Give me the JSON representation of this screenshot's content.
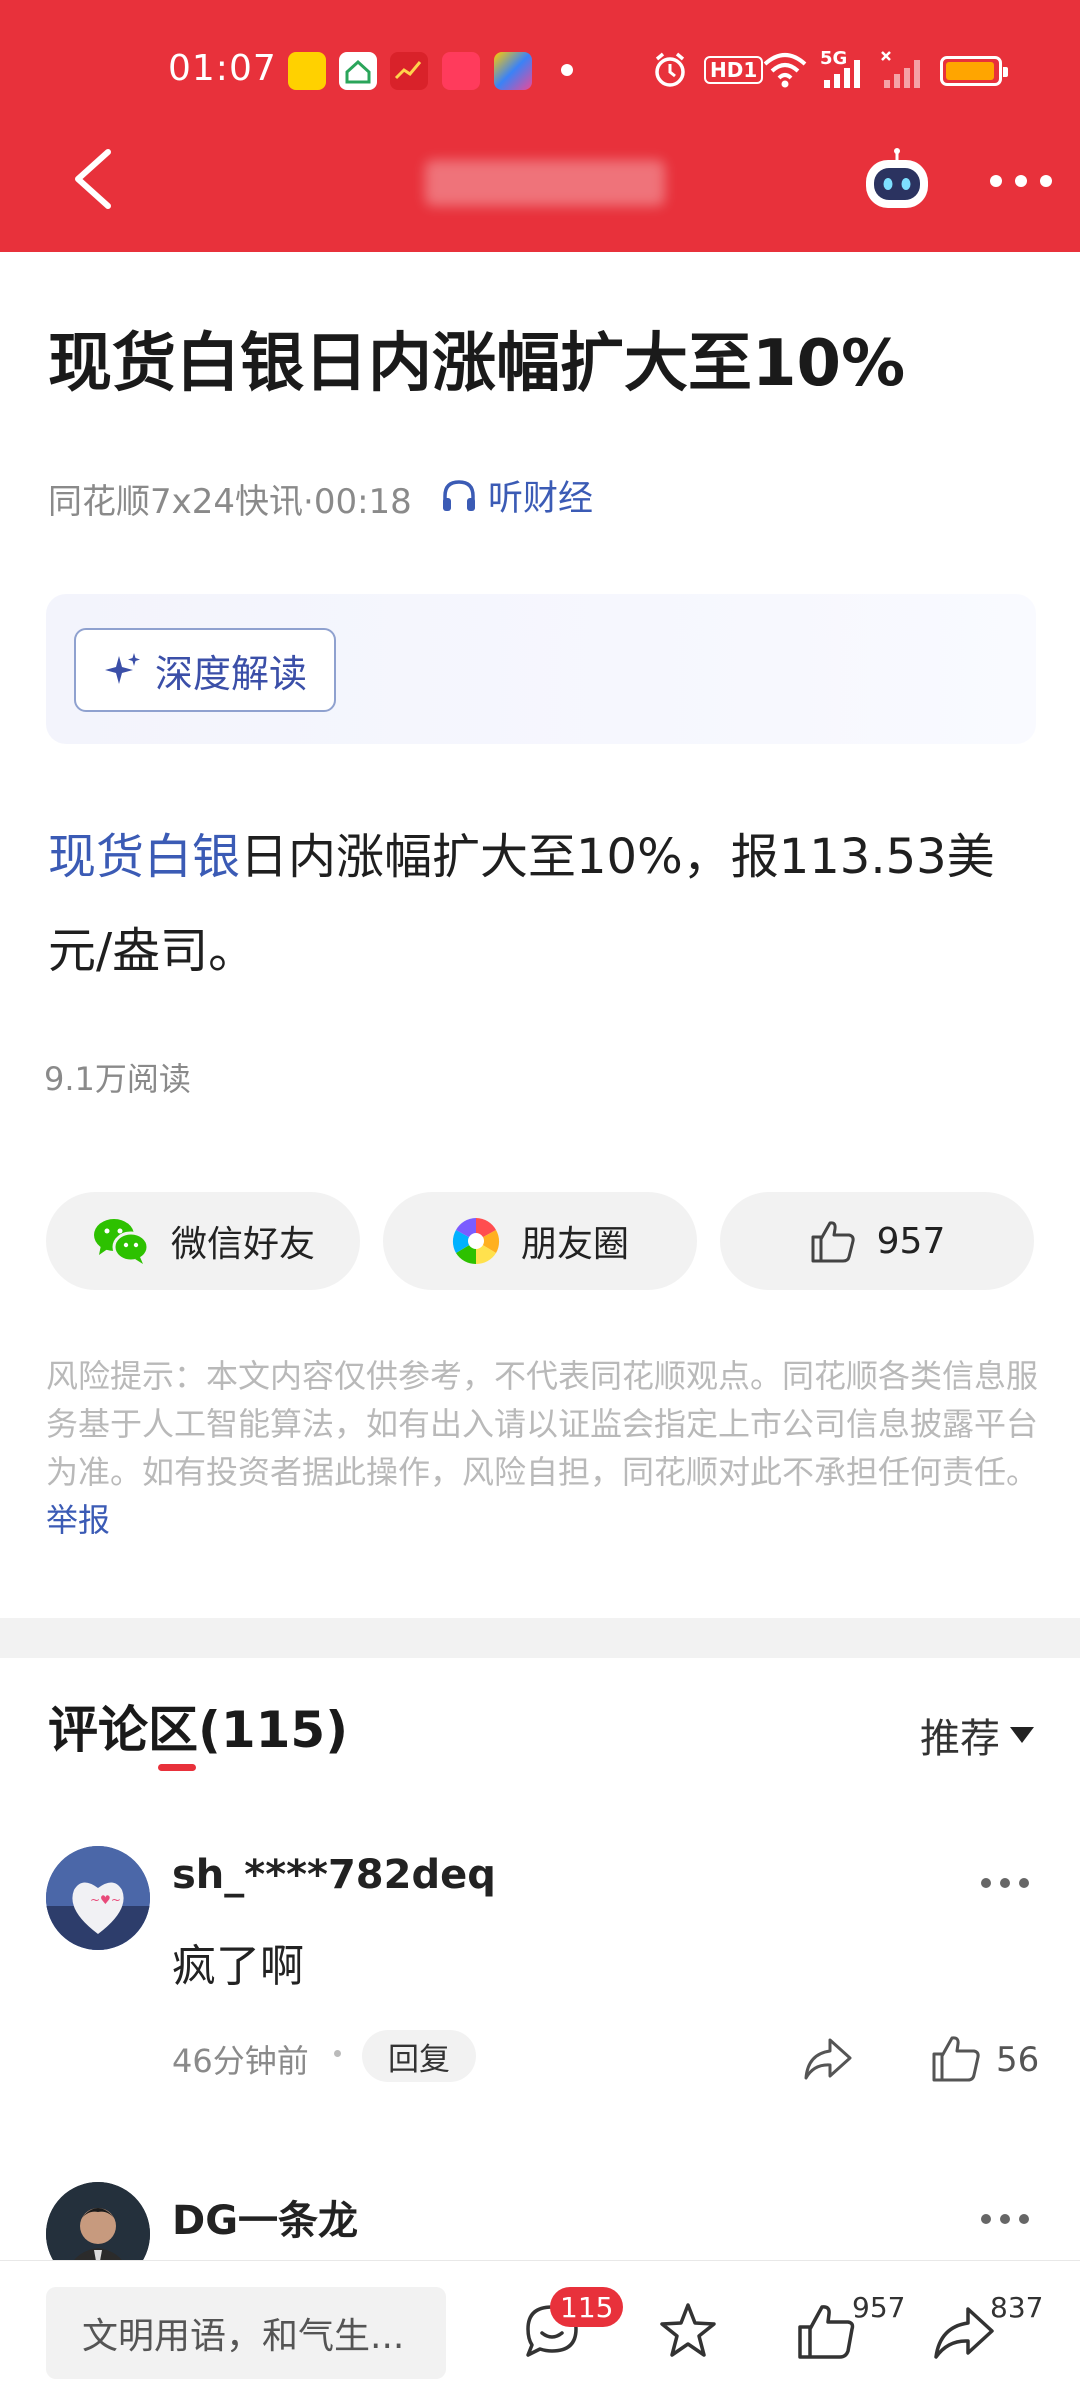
{
  "status_bar": {
    "time": "01:07",
    "hd_label": "HD1",
    "network": "5G"
  },
  "nav": {
    "back_icon": "chevron-left-icon",
    "assistant_icon": "robot-icon",
    "more_icon": "more-dots-icon"
  },
  "article": {
    "title": "现货白银日内涨幅扩大至10%",
    "meta": "同花顺7x24快讯·00:18",
    "listen_label": "听财经",
    "deep_read_label": "深度解读",
    "body_link": "现货白银",
    "body_rest": "日内涨幅扩大至10%，报113.53美元/盎司。",
    "reads": "9.1万阅读"
  },
  "share": {
    "wechat_label": "微信好友",
    "moments_label": "朋友圈",
    "like_count": "957"
  },
  "risk": {
    "text": "风险提示：本文内容仅供参考，不代表同花顺观点。同花顺各类信息服务基于人工智能算法，如有出入请以证监会指定上市公司信息披露平台为准。如有投资者据此操作，风险自担，同花顺对此不承担任何责任。",
    "report_label": "举报"
  },
  "comments": {
    "header": "评论区(115)",
    "sort_label": "推荐",
    "items": [
      {
        "user": "sh_****782deq",
        "text": "疯了啊",
        "time": "46分钟前",
        "reply_label": "回复",
        "likes": "56"
      },
      {
        "user": "DG一条龙"
      }
    ]
  },
  "bottom_bar": {
    "input_placeholder": "文明用语，和气生...",
    "comment_count": "115",
    "like_count": "957",
    "share_count": "837"
  },
  "colors": {
    "brand_red": "#e8313b",
    "link_blue": "#3b5bb5",
    "battery": "#ffa500"
  }
}
